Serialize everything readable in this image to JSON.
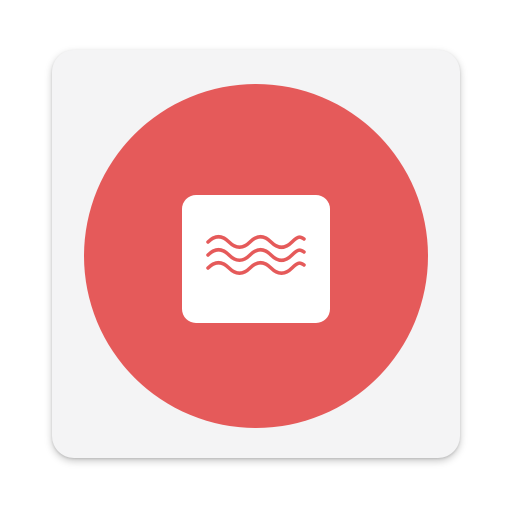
{
  "app_icon": {
    "icon_name": "waves-card-icon",
    "colors": {
      "tile_background": "#f4f4f5",
      "circle": "#e55a5a",
      "card": "#ffffff",
      "waves": "#e55a5a"
    }
  }
}
